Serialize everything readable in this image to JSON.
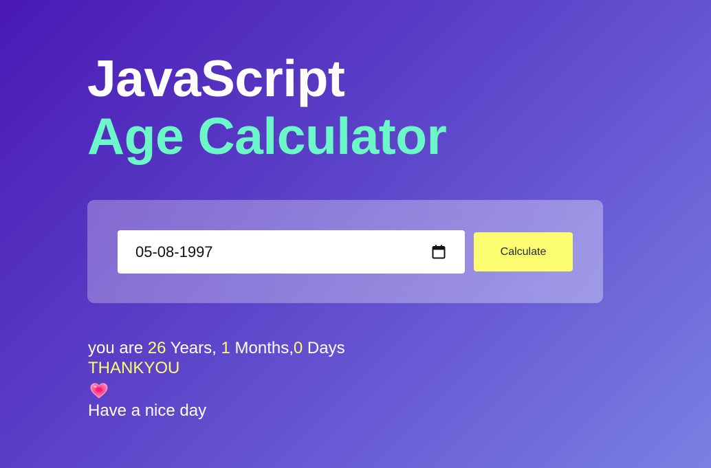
{
  "header": {
    "title_line_1": "JavaScript",
    "title_line_2": "Age Calculator"
  },
  "form": {
    "date_value": "05-08-1997",
    "calculate_label": "Calculate",
    "calendar_icon": "calendar-icon"
  },
  "result": {
    "prefix": "you are ",
    "years": "26",
    "years_label": " Years, ",
    "months": "1",
    "months_label": " Months,",
    "days": "0",
    "days_label": " Days",
    "thanks": "THANKYOU",
    "heart_icon": "heart-icon",
    "closing": "Have a nice day"
  },
  "colors": {
    "accent_green": "#6cf7c9",
    "accent_yellow": "#fdfd71",
    "background_start": "#4a18b5",
    "background_end": "#7a80e2"
  }
}
